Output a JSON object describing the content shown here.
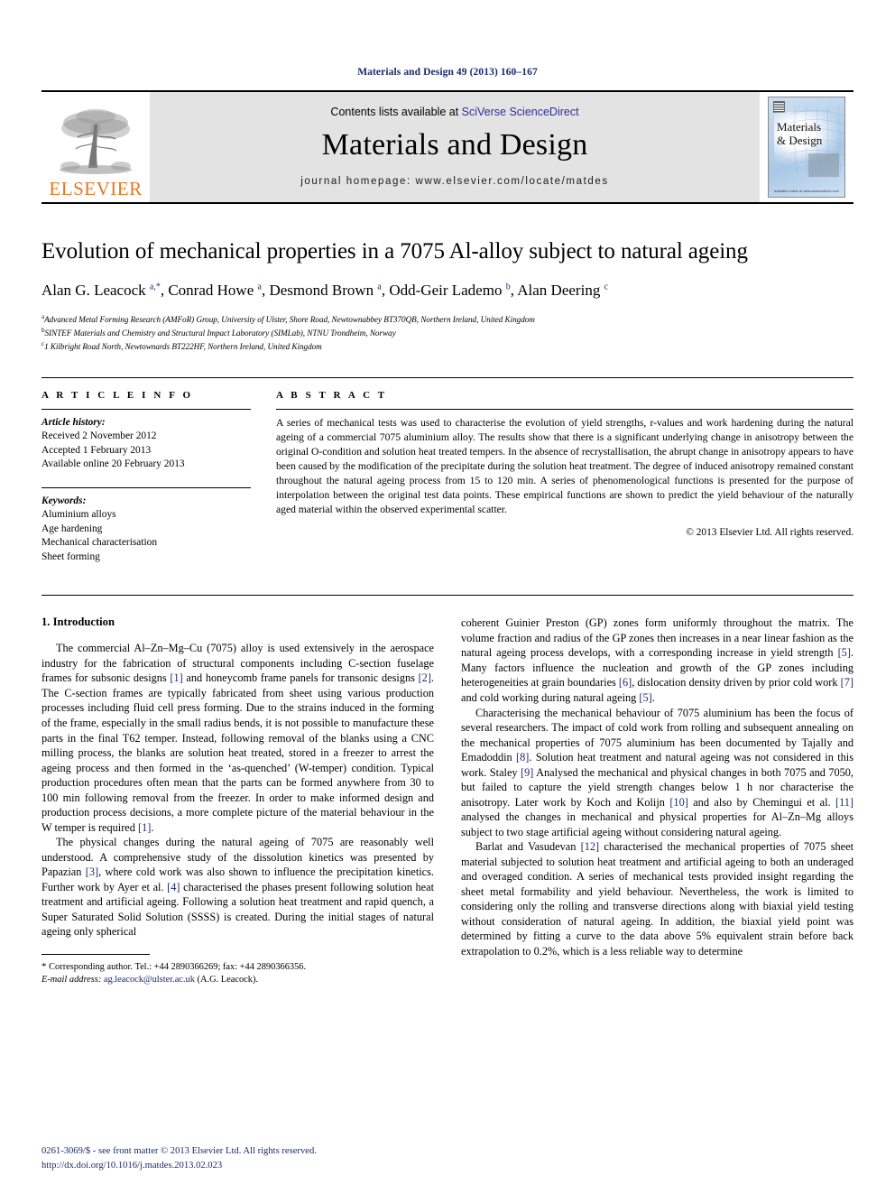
{
  "running_head": "Materials and Design 49 (2013) 160–167",
  "journal_header": {
    "contents_prefix": "Contents lists available at",
    "contents_link": "SciVerse ScienceDirect",
    "journal_name": "Materials and Design",
    "homepage_label": "journal homepage: www.elsevier.com/locate/matdes",
    "publisher_name": "ELSEVIER",
    "cover_title_line1": "Materials",
    "cover_title_line2": "& Design",
    "cover_footer": "available online at www.sciencedirect.com",
    "accent_orange": "#E87722",
    "link_blue": "#2b2f9e",
    "band_gray": "#e3e3e3"
  },
  "article": {
    "title": "Evolution of mechanical properties in a 7075 Al-alloy subject to natural ageing",
    "authors_html": "Alan G. Leacock <sup>a,*</sup>, Conrad Howe <sup>a</sup>, Desmond Brown <sup>a</sup>, Odd-Geir Lademo <sup>b</sup>, Alan Deering <sup>c</sup>",
    "affiliations": [
      {
        "marker": "a",
        "text": "Advanced Metal Forming Research (AMFoR) Group, University of Ulster, Shore Road, Newtownabbey BT370QB, Northern Ireland, United Kingdom"
      },
      {
        "marker": "b",
        "text": "SINTEF Materials and Chemistry and Structural Impact Laboratory (SIMLab), NTNU Trondheim, Norway"
      },
      {
        "marker": "c",
        "text": "1 Kilbright Road North, Newtownards BT222HF, Northern Ireland, United Kingdom"
      }
    ]
  },
  "article_info": {
    "heading": "A R T I C L E   I N F O",
    "history_label": "Article history:",
    "history": [
      "Received 2 November 2012",
      "Accepted 1 February 2013",
      "Available online 20 February 2013"
    ],
    "keywords_label": "Keywords:",
    "keywords": [
      "Aluminium alloys",
      "Age hardening",
      "Mechanical characterisation",
      "Sheet forming"
    ]
  },
  "abstract": {
    "heading": "A B S T R A C T",
    "text": "A series of mechanical tests was used to characterise the evolution of yield strengths, r-values and work hardening during the natural ageing of a commercial 7075 aluminium alloy. The results show that there is a significant underlying change in anisotropy between the original O-condition and solution heat treated tempers. In the absence of recrystallisation, the abrupt change in anisotropy appears to have been caused by the modification of the precipitate during the solution heat treatment. The degree of induced anisotropy remained constant throughout the natural ageing process from 15 to 120 min. A series of phenomenological functions is presented for the purpose of interpolation between the original test data points. These empirical functions are shown to predict the yield behaviour of the naturally aged material within the observed experimental scatter.",
    "copyright": "© 2013 Elsevier Ltd. All rights reserved."
  },
  "body": {
    "section_heading": "1. Introduction",
    "left_paragraphs": [
      "The commercial Al–Zn–Mg–Cu (7075) alloy is used extensively in the aerospace industry for the fabrication of structural components including C-section fuselage frames for subsonic designs [1] and honeycomb frame panels for transonic designs [2]. The C-section frames are typically fabricated from sheet using various production processes including fluid cell press forming. Due to the strains induced in the forming of the frame, especially in the small radius bends, it is not possible to manufacture these parts in the final T62 temper. Instead, following removal of the blanks using a CNC milling process, the blanks are solution heat treated, stored in a freezer to arrest the ageing process and then formed in the ‘as-quenched’ (W-temper) condition. Typical production procedures often mean that the parts can be formed anywhere from 30 to 100 min following removal from the freezer. In order to make informed design and production process decisions, a more complete picture of the material behaviour in the W temper is required [1].",
      "The physical changes during the natural ageing of 7075 are reasonably well understood. A comprehensive study of the dissolution kinetics was presented by Papazian [3], where cold work was also shown to influence the precipitation kinetics. Further work by Ayer et al. [4] characterised the phases present following solution heat treatment and artificial ageing. Following a solution heat treatment and rapid quench, a Super Saturated Solid Solution (SSSS) is created. During the initial stages of natural ageing only spherical"
    ],
    "right_paragraphs": [
      "coherent Guinier Preston (GP) zones form uniformly throughout the matrix. The volume fraction and radius of the GP zones then increases in a near linear fashion as the natural ageing process develops, with a corresponding increase in yield strength [5]. Many factors influence the nucleation and growth of the GP zones including heterogeneities at grain boundaries [6], dislocation density driven by prior cold work [7] and cold working during natural ageing [5].",
      "Characterising the mechanical behaviour of 7075 aluminium has been the focus of several researchers. The impact of cold work from rolling and subsequent annealing on the mechanical properties of 7075 aluminium has been documented by Tajally and Emadoddin [8]. Solution heat treatment and natural ageing was not considered in this work. Staley [9] Analysed the mechanical and physical changes in both 7075 and 7050, but failed to capture the yield strength changes below 1 h nor characterise the anisotropy. Later work by Koch and Kolijn [10] and also by Chemingui et al. [11] analysed the changes in mechanical and physical properties for Al–Zn–Mg alloys subject to two stage artificial ageing without considering natural ageing.",
      "Barlat and Vasudevan [12] characterised the mechanical properties of 7075 sheet material subjected to solution heat treatment and artificial ageing to both an underaged and overaged condition. A series of mechanical tests provided insight regarding the sheet metal formability and yield behaviour. Nevertheless, the work is limited to considering only the rolling and transverse directions along with biaxial yield testing without consideration of natural ageing. In addition, the biaxial yield point was determined by fitting a curve to the data above 5% equivalent strain before back extrapolation to 0.2%, which is a less reliable way to determine"
    ]
  },
  "footnote": {
    "star": "*",
    "corresponding": "Corresponding author. Tel.: +44 2890366269; fax: +44 2890366356.",
    "email_label": "E-mail address:",
    "email": "ag.leacock@ulster.ac.uk",
    "email_suffix": "(A.G. Leacock)."
  },
  "imprint": {
    "line1": "0261-3069/$ - see front matter © 2013 Elsevier Ltd. All rights reserved.",
    "line2": "http://dx.doi.org/10.1016/j.matdes.2013.02.023"
  }
}
